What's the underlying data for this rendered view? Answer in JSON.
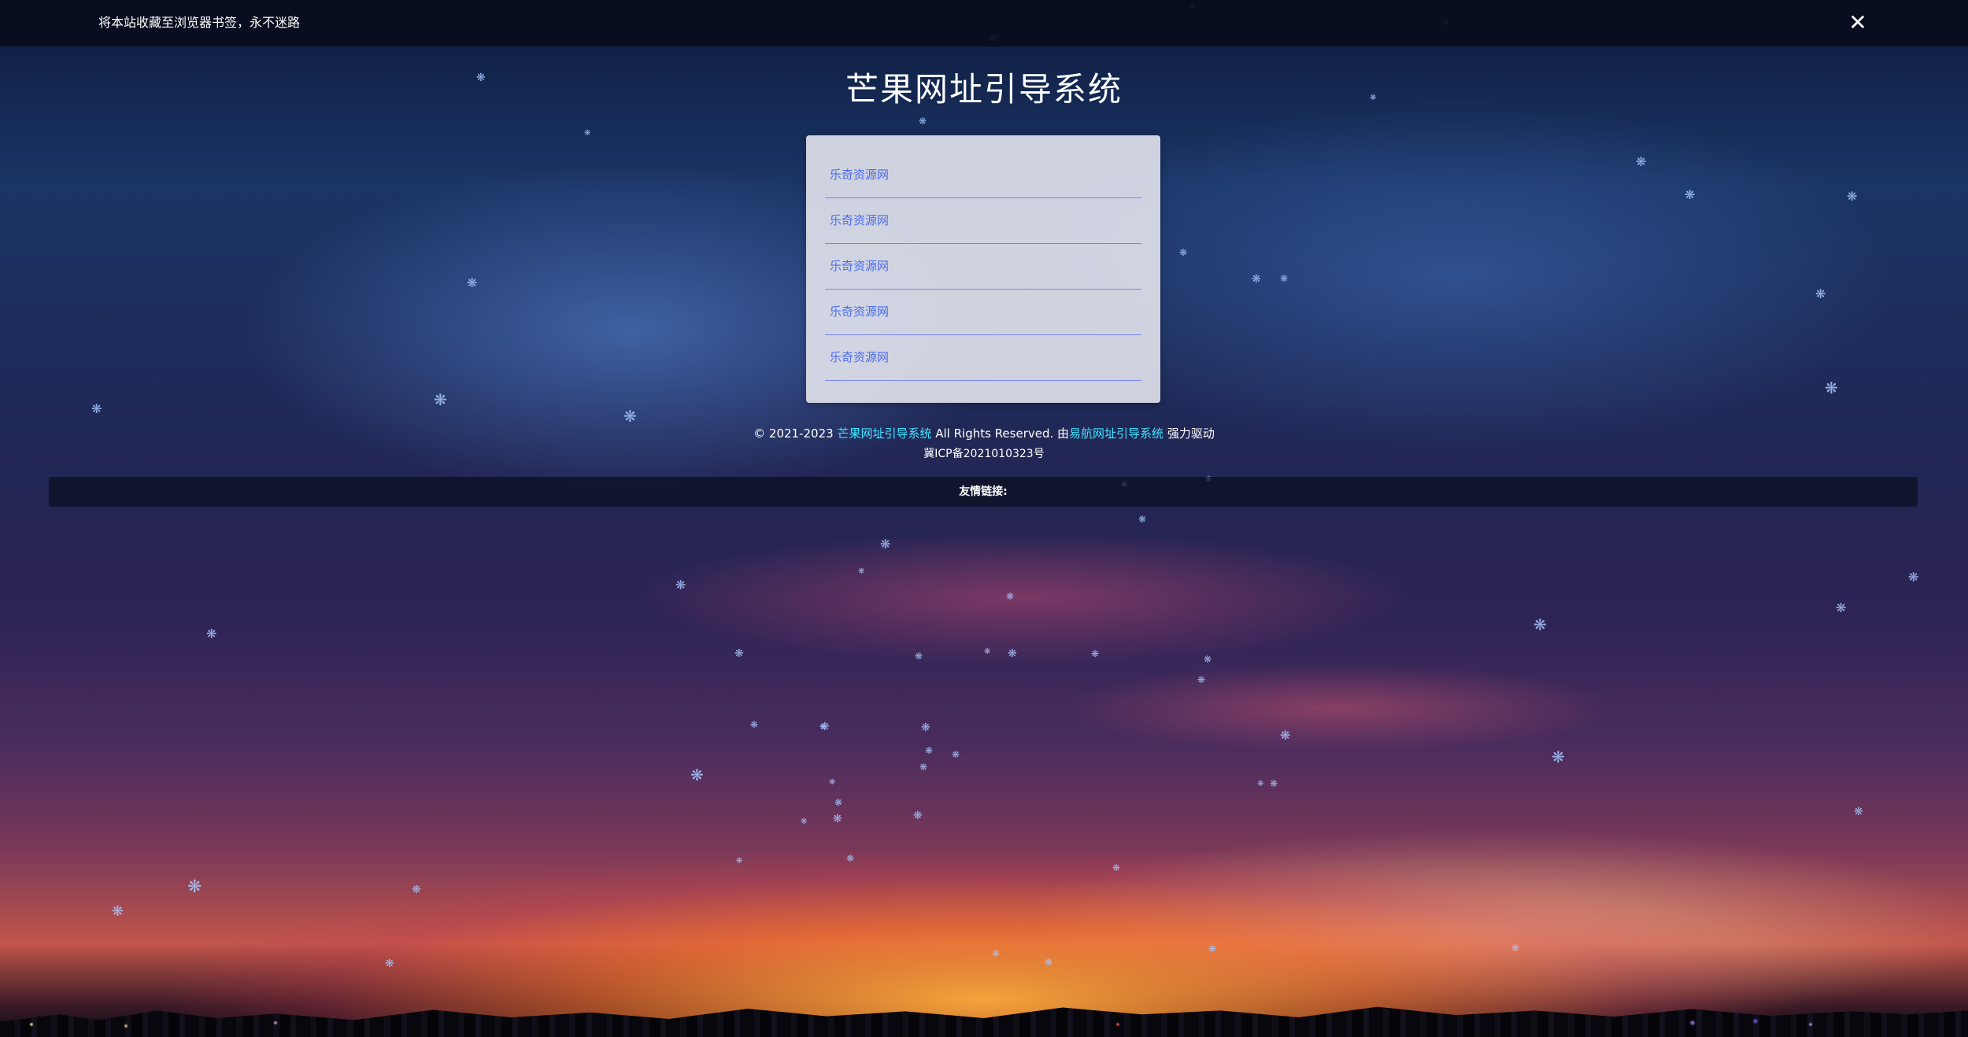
{
  "notice": {
    "text": "将本站收藏至浏览器书签，永不迷路",
    "close_icon": "✕"
  },
  "site": {
    "title": "芒果网址引导系统"
  },
  "links": [
    {
      "label": "乐奇资源网"
    },
    {
      "label": "乐奇资源网"
    },
    {
      "label": "乐奇资源网"
    },
    {
      "label": "乐奇资源网"
    },
    {
      "label": "乐奇资源网"
    }
  ],
  "footer": {
    "copyright_prefix": "© 2021-2023 ",
    "site_link": "芒果网址引导系统",
    "rights": " All Rights Reserved. 由",
    "powered_link": "易航网址引导系统",
    "powered_suffix": " 强力驱动",
    "icp": "冀ICP备2021010323号"
  },
  "friend_links": {
    "label": "友情链接:"
  },
  "colors": {
    "highlight_link": "#3fe3ff",
    "card_link": "#4a6cf0",
    "card_divider": "#7a86f0",
    "snowflake": "#a9c9ff"
  },
  "icons": {
    "close": "close-icon",
    "snowflake": "snowflake-icon"
  }
}
